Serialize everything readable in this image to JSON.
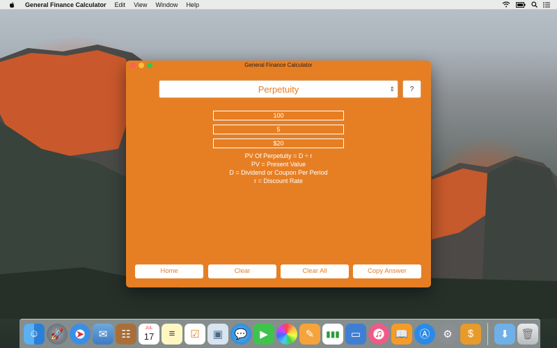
{
  "menubar": {
    "app_name": "General Finance Calculator",
    "menus": [
      "Edit",
      "View",
      "Window",
      "Help"
    ]
  },
  "window": {
    "title": "General Finance Calculator",
    "calculation_select": "Perpetuity",
    "help_label": "?",
    "inputs": [
      "100",
      "5",
      "$20"
    ],
    "formula_lines": [
      "PV Of Perpetuity = D ÷ r",
      "PV = Present Value",
      "D = Dividend or Coupon Per Period",
      "r = Discount Rate"
    ],
    "buttons": {
      "home": "Home",
      "clear": "Clear",
      "clear_all": "Clear All",
      "copy_answer": "Copy Answer"
    },
    "accent_color": "#e67f24"
  },
  "dock": {
    "icons": [
      "finder-icon",
      "launchpad-icon",
      "safari-icon",
      "mail-icon",
      "contacts-icon",
      "calendar-icon",
      "notes-icon",
      "reminders-icon",
      "preview-icon",
      "messages-icon",
      "facetime-icon",
      "photos-icon",
      "pages-icon",
      "numbers-icon",
      "keynote-icon",
      "itunes-icon",
      "ibooks-icon",
      "app-store-icon",
      "system-preferences-icon",
      "finance-app-icon",
      "downloads-icon",
      "trash-icon"
    ],
    "calendar_day": "17",
    "calendar_month": "JUL"
  }
}
